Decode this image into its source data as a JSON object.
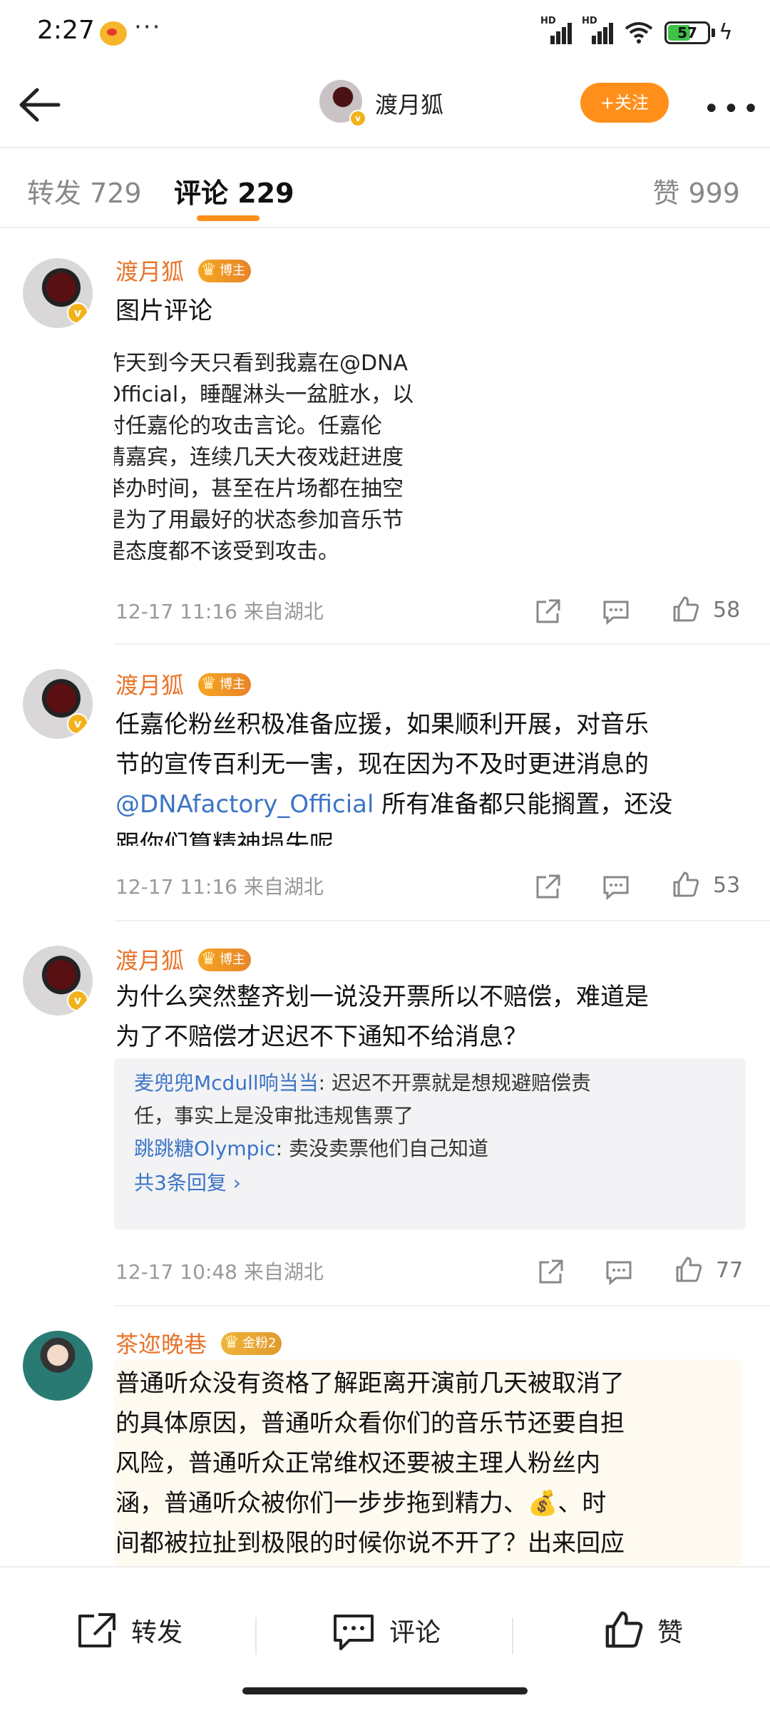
{
  "status": {
    "time": "2:27",
    "dots": "···",
    "signal1": "HD",
    "signal2": "HD",
    "battery": "57",
    "battery_level": 0.57
  },
  "nav": {
    "name": "渡月狐",
    "follow": "+关注"
  },
  "tabs": {
    "repost": "转发 729",
    "comment": "评论 229",
    "like": "赞 999"
  },
  "comments": [
    {
      "name": "渡月狐",
      "badge": "博主",
      "text": "图片评论",
      "image_lines": [
        "昨天到今天只看到我嘉在@DNA",
        "Official，睡醒淋头一盆脏水，以",
        "对任嘉伦的攻击言论。任嘉伦",
        "请嘉宾，连续几天大夜戏赶进度",
        "举办时间，甚至在片场都在抽空",
        "是为了用最好的状态参加音乐节",
        "是态度都不该受到攻击。"
      ],
      "meta": "12-17 11:16  来自湖北",
      "likes": "58"
    },
    {
      "name": "渡月狐",
      "badge": "博主",
      "text_lines": [
        "任嘉伦粉丝积极准备应援，如果顺利开展，对音乐",
        "节的宣传百利无一害，现在因为不及时更进消息的"
      ],
      "mention": "@DNAfactory_Official",
      "text_after": " 所有准备都只能搁置，还没",
      "text_last": "跟你们算精神损失呢",
      "meta": "12-17 11:16  来自湖北",
      "likes": "53"
    },
    {
      "name": "渡月狐",
      "badge": "博主",
      "text_lines": [
        "为什么突然整齐划一说没开票所以不赔偿，难道是",
        "为了不赔偿才迟迟不下通知不给消息？"
      ],
      "replies": [
        {
          "user": "麦兜兜Mcdull响当当",
          "text": ": 迟迟不开票就是想规避赔偿责",
          "cont": "任，事实上是没审批违规售票了"
        },
        {
          "user": "跳跳糖Olympic",
          "text": ": 卖没卖票他们自己知道"
        }
      ],
      "more_replies": "共3条回复 ›",
      "meta": "12-17 10:48  来自湖北",
      "likes": "77"
    },
    {
      "name": "茶迩晚巷",
      "badge": "金粉2",
      "text_lines": [
        "普通听众没有资格了解距离开演前几天被取消了",
        "的具体原因，普通听众看你们的音乐节还要自担",
        "风险，普通听众正常维权还要被主理人粉丝内",
        "涵，普通听众被你们一步步拖到精力、💰、时",
        "间都被拉扯到极限的时候你说不开了？出来回应"
      ]
    }
  ],
  "bottom": {
    "repost": "转发",
    "comment": "评论",
    "like": "赞"
  },
  "colors": {
    "accent": "#ff8f1a",
    "name": "#e8742a",
    "link": "#3b74c5"
  }
}
